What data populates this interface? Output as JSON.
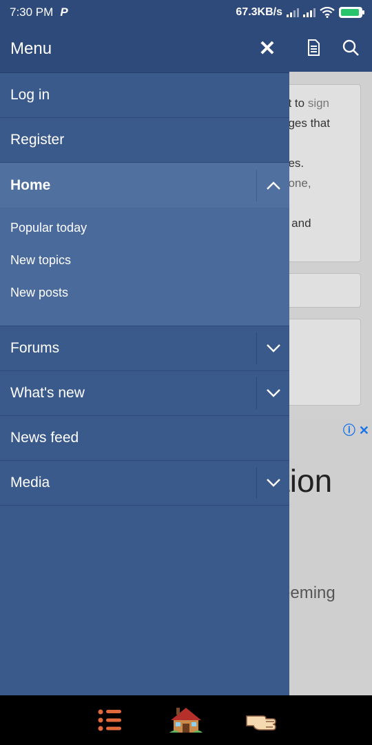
{
  "status_bar": {
    "time": "7:30 PM",
    "app_icon": "P",
    "network_speed": "67.3KB/s",
    "signal_icons": [
      "signal-icon",
      "signal-icon"
    ],
    "wifi_icon": "wifi-icon",
    "battery_icon": "battery-charging-icon"
  },
  "drawer": {
    "title": "Menu",
    "close_icon": "close-icon",
    "items": [
      {
        "label": "Log in"
      },
      {
        "label": "Register"
      },
      {
        "label": "Home",
        "expanded": true,
        "submenu": [
          "Popular today",
          "New topics",
          "New posts"
        ]
      },
      {
        "label": "Forums",
        "expandable": true
      },
      {
        "label": "What's new",
        "expandable": true
      },
      {
        "label": "News feed"
      },
      {
        "label": "Media",
        "expandable": true
      }
    ]
  },
  "background_page": {
    "header_icons": [
      "document-icon",
      "search-icon"
    ],
    "card1_lines": [
      "nt to sign",
      "eges that",
      "",
      "ues.",
      "hone,",
      "",
      "e and"
    ],
    "ad_title": "tion",
    "ad_text": "eeming"
  },
  "bottom_nav": {
    "icons": [
      "list-icon",
      "home-icon",
      "pointing-hand-icon"
    ]
  },
  "colors": {
    "header": "#2e4a7a",
    "drawer": "#3b5a8c",
    "home_row": "#5070a0",
    "submenu": "#4a6a9c"
  }
}
